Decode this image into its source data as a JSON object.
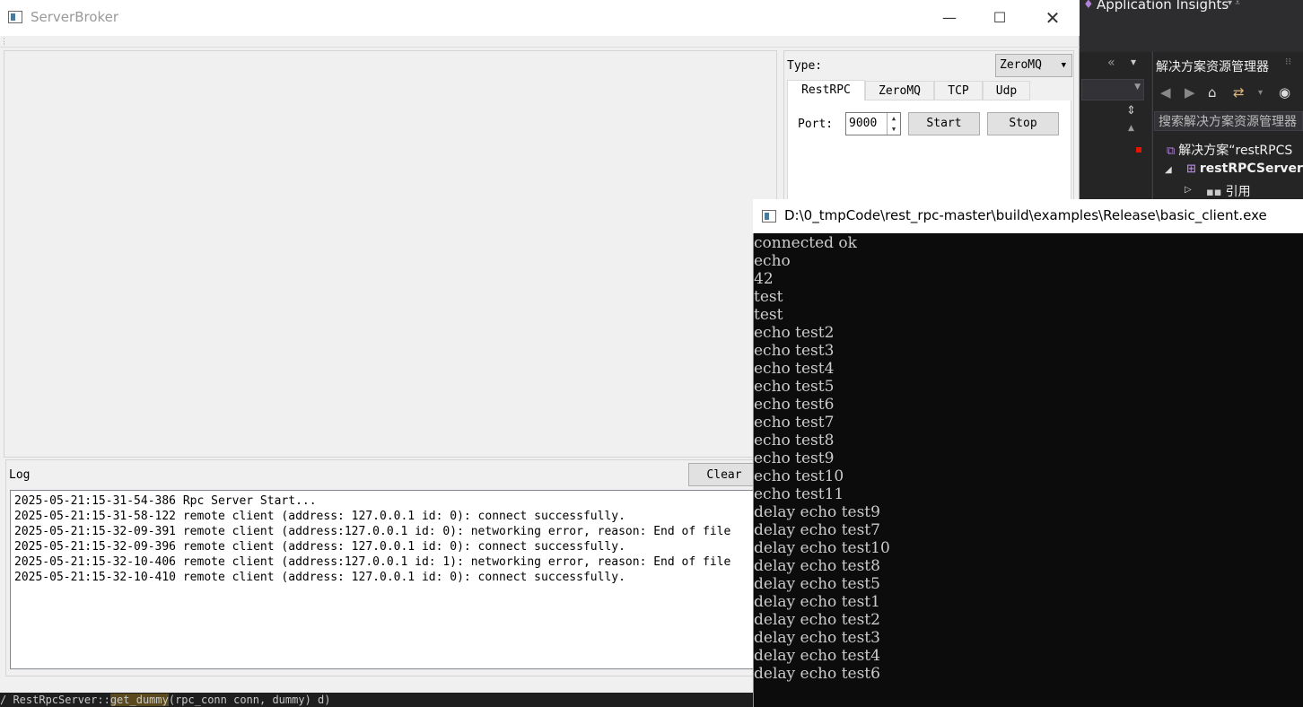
{
  "vs": {
    "app_insights": "Application Insights",
    "solution_explorer_title": "解决方案资源管理器",
    "search_placeholder": "搜索解决方案资源管理器",
    "tree": [
      {
        "label": "解决方案“restRPCS"
      },
      {
        "label": "restRPCServer"
      },
      {
        "label": "引用"
      }
    ],
    "bottom_code_a": "/ RestRpcServer::",
    "bottom_code_hl": "get_dummy",
    "bottom_code_b": "(rpc_conn conn, dummy) d)    "
  },
  "server_broker": {
    "title": "ServerBroker",
    "type_label": "Type:",
    "type_value": "ZeroMQ",
    "tabs": [
      {
        "label": "RestRPC",
        "active": true
      },
      {
        "label": "ZeroMQ",
        "active": false
      },
      {
        "label": "TCP",
        "active": false
      },
      {
        "label": "Udp",
        "active": false
      }
    ],
    "port_label": "Port:",
    "port_value": "9000",
    "start_label": "Start",
    "stop_label": "Stop",
    "log_label": "Log",
    "clear_label": "Clear",
    "log_lines": [
      "2025-05-21:15-31-54-386 Rpc Server Start...",
      "2025-05-21:15-31-58-122 remote client (address: 127.0.0.1 id: 0): connect successfully.",
      "2025-05-21:15-32-09-391 remote client (address:127.0.0.1 id: 0): networking error, reason: End of file",
      "2025-05-21:15-32-09-396 remote client (address: 127.0.0.1 id: 0): connect successfully.",
      "2025-05-21:15-32-10-406 remote client (address:127.0.0.1 id: 1): networking error, reason: End of file",
      "2025-05-21:15-32-10-410 remote client (address: 127.0.0.1 id: 0): connect successfully."
    ]
  },
  "console": {
    "title": "D:\\0_tmpCode\\rest_rpc-master\\build\\examples\\Release\\basic_client.exe",
    "lines": [
      "connected ok",
      "echo",
      "42",
      "test",
      "test",
      "echo test2",
      "echo test3",
      "echo test4",
      "echo test5",
      "echo test6",
      "echo test7",
      "echo test8",
      "echo test9",
      "echo test10",
      "echo test11",
      "delay echo test9",
      "delay echo test7",
      "delay echo test10",
      "delay echo test8",
      "delay echo test5",
      "delay echo test1",
      "delay echo test2",
      "delay echo test3",
      "delay echo test4",
      "delay echo test6"
    ]
  }
}
